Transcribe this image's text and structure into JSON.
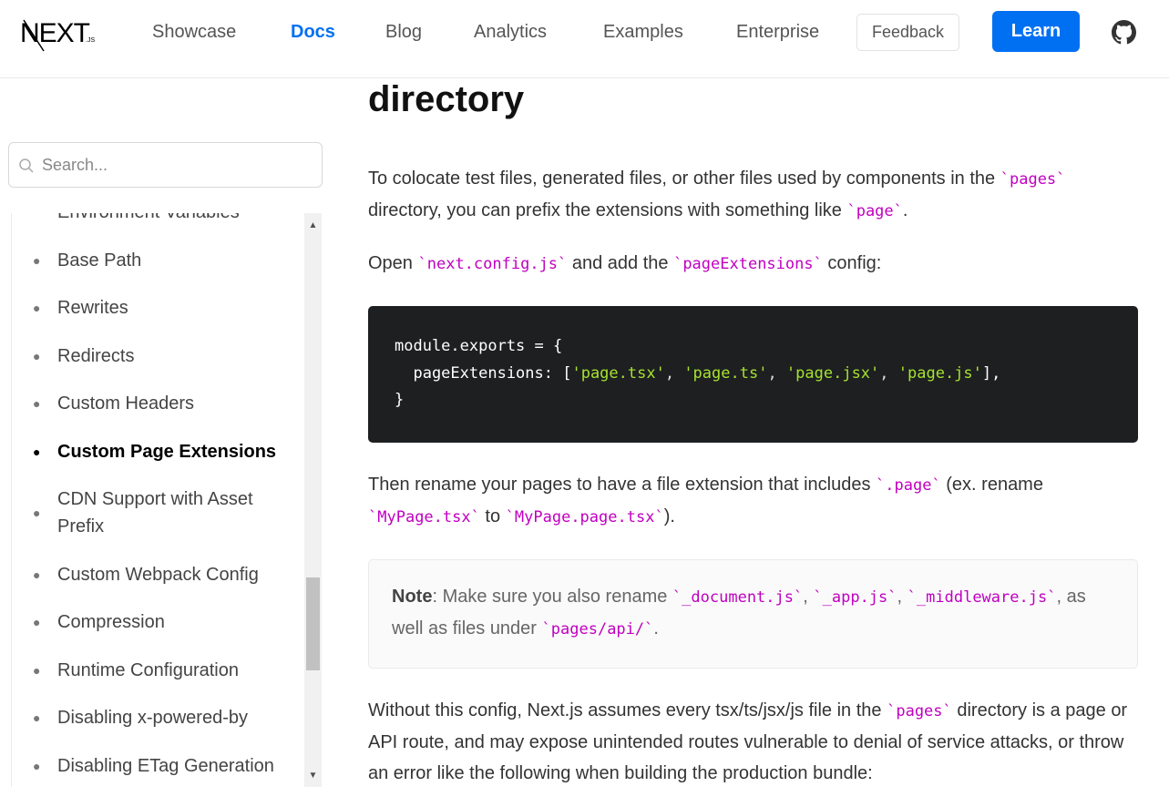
{
  "header": {
    "logo_text": "NEXT",
    "logo_suffix": ".JS",
    "nav": [
      {
        "label": "Showcase",
        "active": false
      },
      {
        "label": "Docs",
        "active": true
      },
      {
        "label": "Blog",
        "active": false
      },
      {
        "label": "Analytics",
        "active": false
      },
      {
        "label": "Examples",
        "active": false
      },
      {
        "label": "Enterprise",
        "active": false
      }
    ],
    "feedback_label": "Feedback",
    "learn_label": "Learn",
    "github_icon": "github-icon"
  },
  "sidebar": {
    "search_placeholder": "Search...",
    "partial_item": "Environment Variables",
    "items": [
      {
        "label": "Base Path"
      },
      {
        "label": "Rewrites"
      },
      {
        "label": "Redirects"
      },
      {
        "label": "Custom Headers"
      },
      {
        "label": "Custom Page Extensions",
        "active": true
      },
      {
        "label": "CDN Support with Asset Prefix"
      },
      {
        "label": "Custom Webpack Config"
      },
      {
        "label": "Compression"
      },
      {
        "label": "Runtime Configuration"
      },
      {
        "label": "Disabling x-powered-by"
      },
      {
        "label": "Disabling ETag Generation"
      }
    ]
  },
  "content": {
    "heading": "directory",
    "p1": {
      "t1": "To colocate test files, generated files, or other files used by components in the ",
      "c1": "pages",
      "t2": " directory, you can prefix the extensions with something like ",
      "c2": "page",
      "t3": "."
    },
    "p2": {
      "t1": "Open ",
      "c1": "next.config.js",
      "t2": " and add the ",
      "c2": "pageExtensions",
      "t3": " config:"
    },
    "code": {
      "line1": "module.exports = {",
      "line2_key": "  pageExtensions: [",
      "line2_items": [
        "'page.tsx'",
        "'page.ts'",
        "'page.jsx'",
        "'page.js'"
      ],
      "line2_end": "],",
      "line3": "}"
    },
    "p3": {
      "t1": "Then rename your pages to have a file extension that includes ",
      "c1": ".page",
      "t2": " (ex. rename ",
      "c2": "MyPage.tsx",
      "t3": " to ",
      "c3": "MyPage.page.tsx",
      "t4": ")."
    },
    "note": {
      "bold": "Note",
      "t1": ": Make sure you also rename ",
      "c1": "_document.js",
      "s1": ", ",
      "c2": "_app.js",
      "s2": ", ",
      "c3": "_middleware.js",
      "t2": ", as well as files under ",
      "c4": "pages/api/",
      "t3": "."
    },
    "p4": {
      "t1": "Without this config, Next.js assumes every tsx/ts/jsx/js file in the ",
      "c1": "pages",
      "t2": " directory is a page or API route, and may expose unintended routes vulnerable to denial of service attacks, or throw an error like the following when building the production bundle:"
    }
  }
}
